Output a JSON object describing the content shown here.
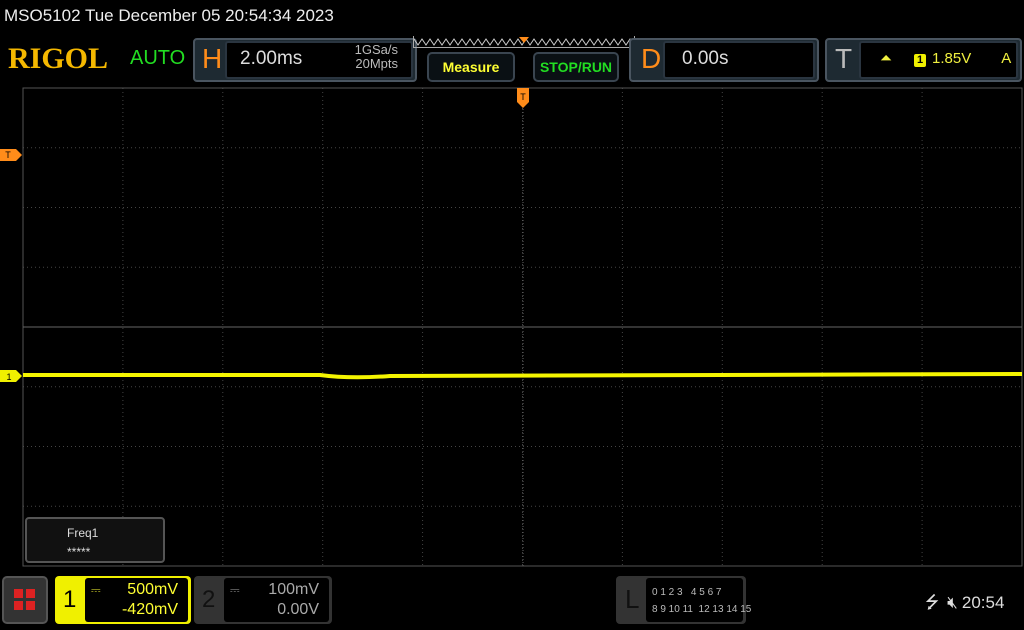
{
  "title": "MSO5102  Tue December 05 20:54:34 2023",
  "logo": "RIGOL",
  "mode": "AUTO",
  "horizontal": {
    "letter": "H",
    "timebase": "2.00ms",
    "sample_rate": "1GSa/s",
    "memory": "20Mpts"
  },
  "buttons": {
    "measure": "Measure",
    "stop_run": "STOP/RUN"
  },
  "delay": {
    "letter": "D",
    "value": "0.00s"
  },
  "trigger": {
    "letter": "T",
    "source": "1",
    "level": "1.85V",
    "mode": "A",
    "marker": "T"
  },
  "measurement": {
    "name": "Freq1",
    "value": "*****"
  },
  "channel1": {
    "num": "1",
    "scale": "500mV",
    "offset": "-420mV",
    "marker": "1",
    "color": "#f0f000"
  },
  "channel2": {
    "num": "2",
    "scale": "100mV",
    "offset": "0.00V"
  },
  "logic": {
    "letter": "L",
    "row1": "0 1 2 3   4 5 6 7",
    "row2": "8 9 10 11  12 13 14 15"
  },
  "status": {
    "time": "20:54"
  }
}
